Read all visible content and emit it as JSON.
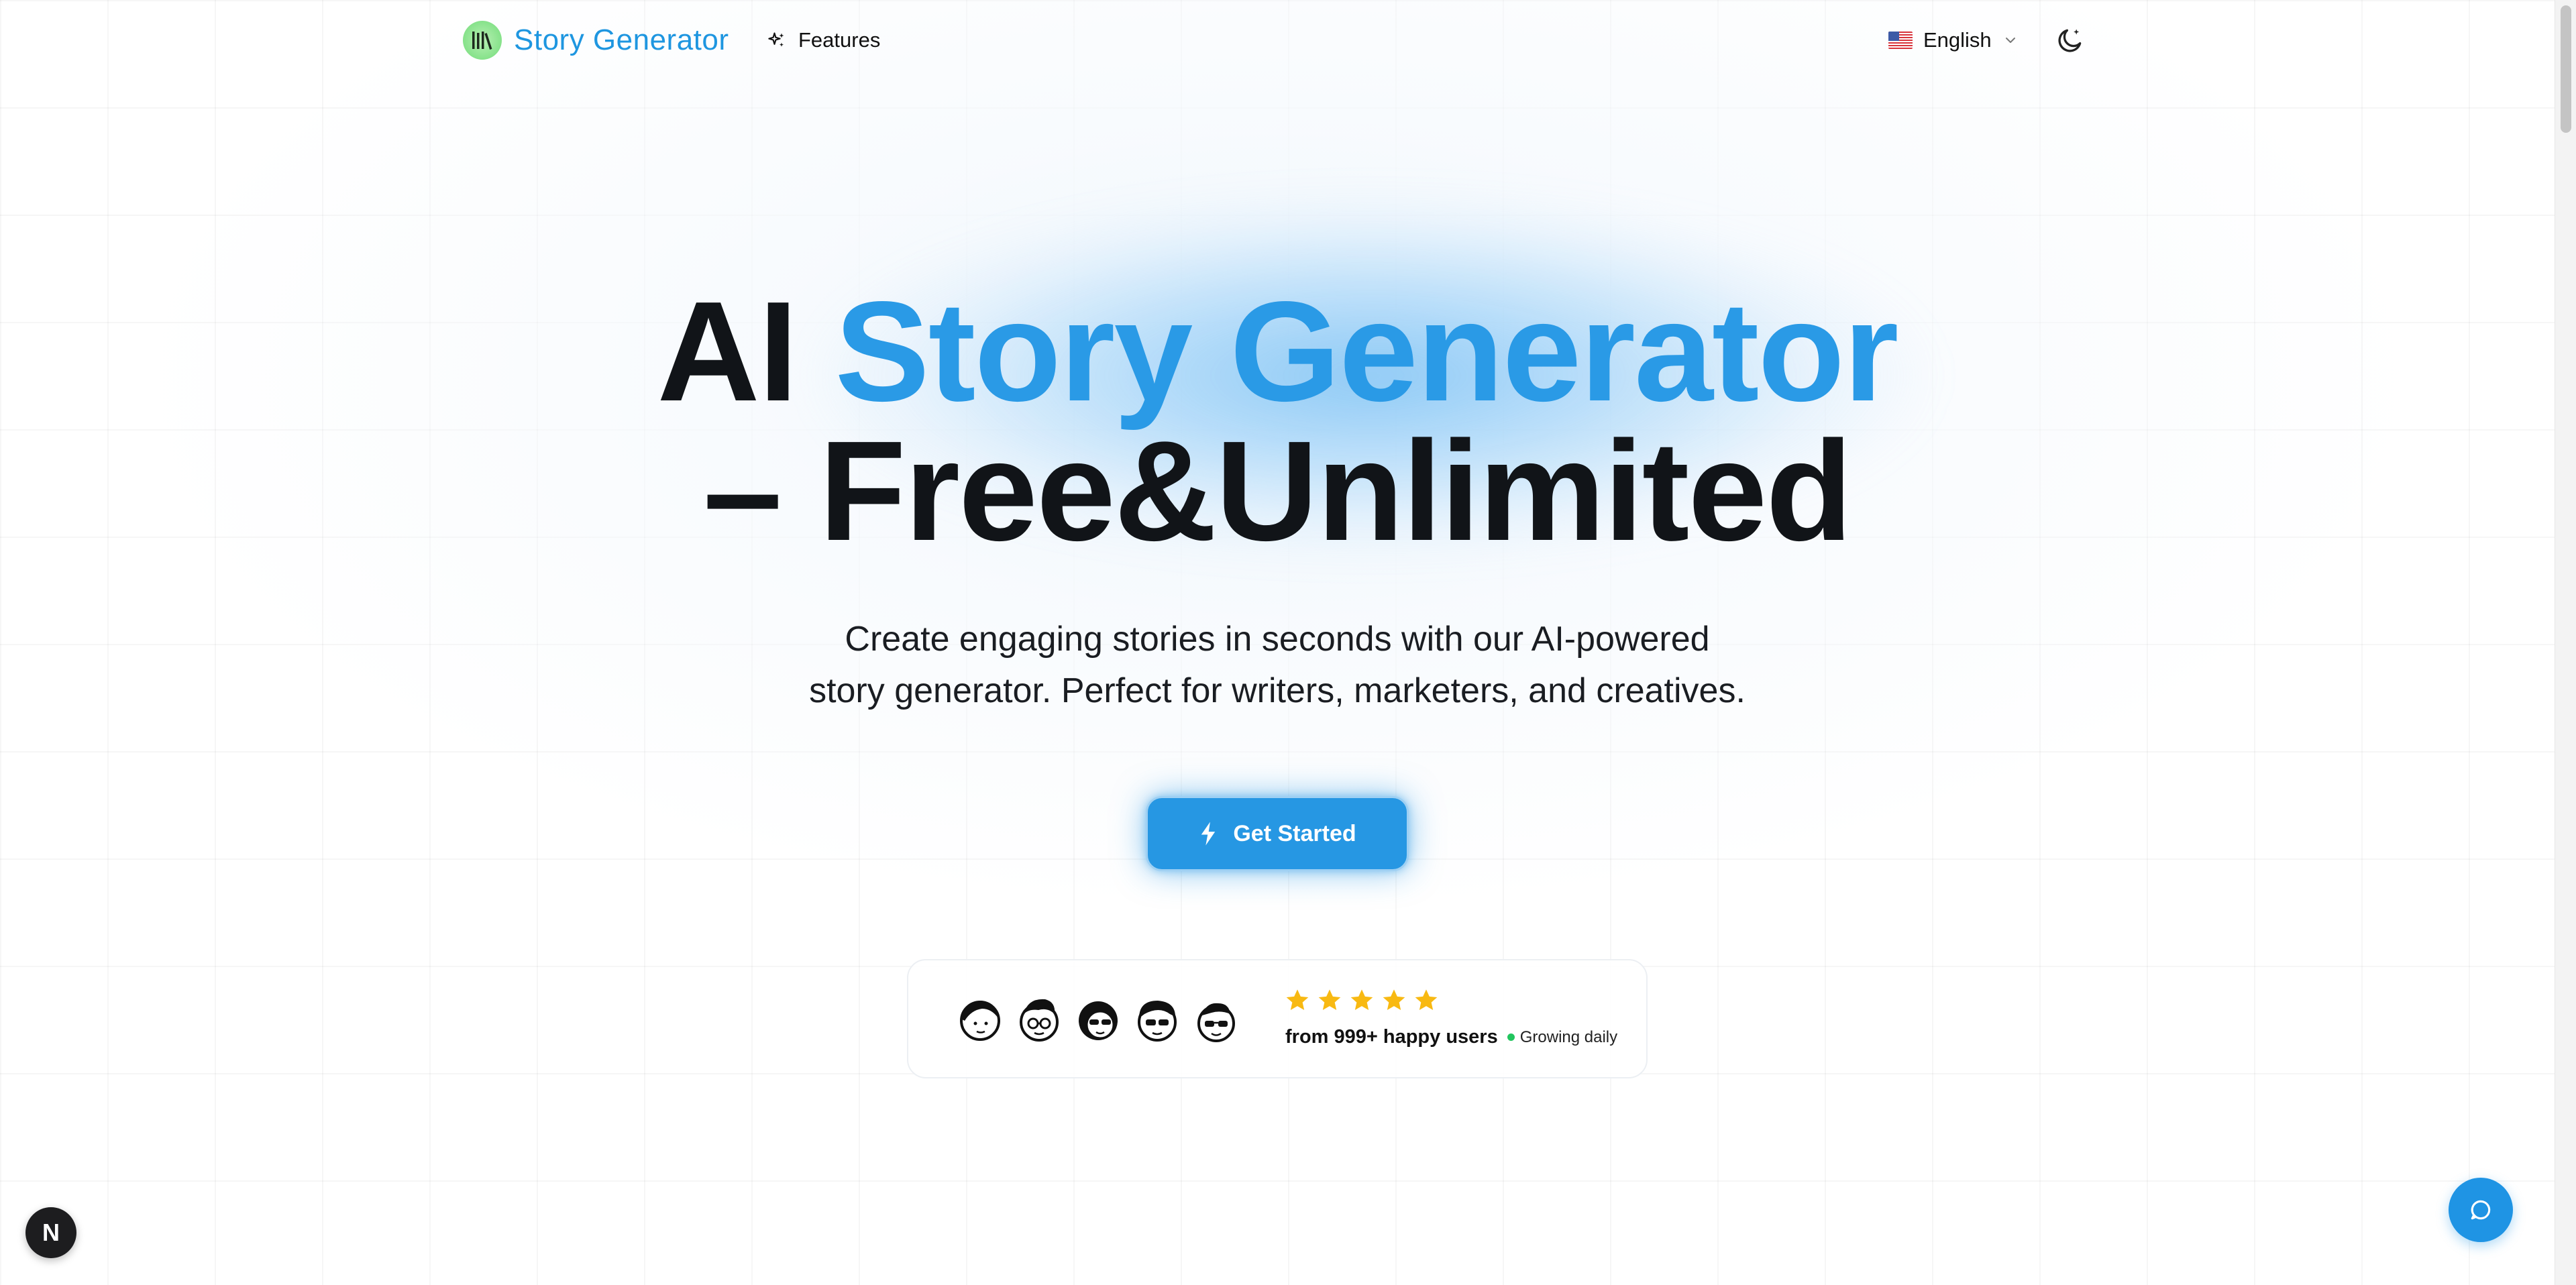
{
  "header": {
    "brand": "Story Generator",
    "nav_features": "Features",
    "language": "English",
    "icons": {
      "logo": "books-icon",
      "features": "sparkles-icon",
      "chevron": "chevron-down-icon",
      "theme": "moon-star-icon",
      "flag": "us-flag-icon"
    }
  },
  "hero": {
    "title_part1": "AI ",
    "title_accent": "Story Generator",
    "title_line2": "– Free&Unlimited",
    "subtitle_line1": "Create engaging stories in seconds with our AI-powered",
    "subtitle_line2": "story generator. Perfect for writers, marketers, and creatives.",
    "cta_label": "Get Started",
    "cta_icon": "lightning-icon"
  },
  "social_proof": {
    "avatar_count": 5,
    "rating_stars": 5,
    "users_text": "from 999+ happy users",
    "growing_text": "Growing daily"
  },
  "floating": {
    "dev_badge_letter": "N",
    "chat_icon": "chat-bubble-icon"
  },
  "colors": {
    "brand_blue": "#2a9ae6",
    "cta_blue": "#2697e3",
    "star_yellow": "#f8b912",
    "status_green": "#22c55e"
  }
}
